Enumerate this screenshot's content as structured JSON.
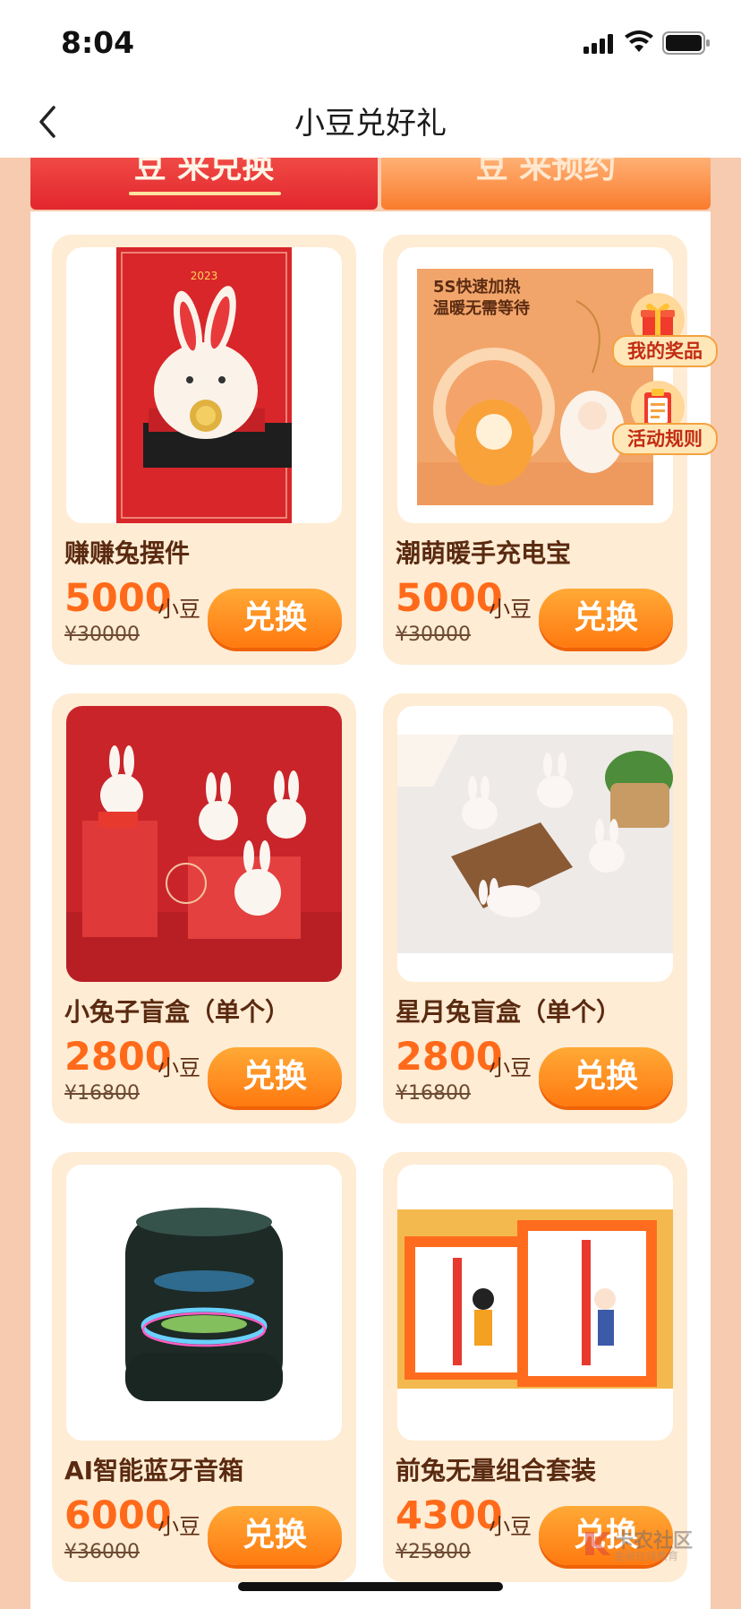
{
  "status": {
    "time": "8:04"
  },
  "nav": {
    "title": "小豆兑好礼"
  },
  "tabs": [
    {
      "label": "豆 来兑换",
      "active": true
    },
    {
      "label": "豆 来预约",
      "active": false
    }
  ],
  "floating": {
    "prizes_label": "我的奖品",
    "rules_label": "活动规则"
  },
  "products": [
    {
      "name": "赚赚兔摆件",
      "price": "5000",
      "unit": "小豆",
      "original": "¥30000",
      "button": "兑换"
    },
    {
      "name": "潮萌暖手充电宝",
      "price": "5000",
      "unit": "小豆",
      "original": "¥30000",
      "button": "兑换"
    },
    {
      "name": "小兔子盲盒（单个）",
      "price": "2800",
      "unit": "小豆",
      "original": "¥16800",
      "button": "兑换"
    },
    {
      "name": "星月兔盲盒（单个）",
      "price": "2800",
      "unit": "小豆",
      "original": "¥16800",
      "button": "兑换"
    },
    {
      "name": "AI智能蓝牙音箱",
      "price": "6000",
      "unit": "小豆",
      "original": "¥36000",
      "button": "兑换"
    },
    {
      "name": "前兔无量组合套装",
      "price": "4300",
      "unit": "小豆",
      "original": "¥25800",
      "button": "兑换"
    }
  ],
  "images": {
    "p1_year": "2023",
    "p2_line1": "5S快速加热",
    "p2_line2": "温暖无需等待"
  },
  "watermark": {
    "title": "卡农社区",
    "subtitle": "金融在线教育"
  },
  "colors": {
    "accent": "#ff7a10",
    "tab_active": "#e2262d",
    "card_bg": "#feecd4",
    "page_bg": "#f7cbb0"
  }
}
